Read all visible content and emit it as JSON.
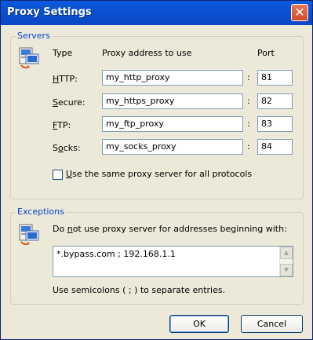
{
  "window": {
    "title": "Proxy Settings",
    "close_glyph": "✕"
  },
  "servers": {
    "group_label": "Servers",
    "headers": {
      "type": "Type",
      "address": "Proxy address to use",
      "port": "Port"
    },
    "rows": [
      {
        "label_accel": "H",
        "label_rest": "TTP:",
        "address": "my_http_proxy",
        "sep": ":",
        "port": "81"
      },
      {
        "label_accel": "S",
        "label_rest": "ecure:",
        "address": "my_https_proxy",
        "sep": ":",
        "port": "82"
      },
      {
        "label_accel": "F",
        "label_rest": "TP:",
        "address": "my_ftp_proxy",
        "sep": ":",
        "port": "83"
      },
      {
        "label_pre": "S",
        "label_accel": "o",
        "label_rest": "cks:",
        "address": "my_socks_proxy",
        "sep": ":",
        "port": "84"
      }
    ],
    "same_proxy": {
      "accel": "U",
      "rest": "se the same proxy server for all protocols",
      "checked": false
    }
  },
  "exceptions": {
    "group_label": "Exceptions",
    "desc_pre": "Do ",
    "desc_accel": "n",
    "desc_post": "ot use proxy server for addresses beginning with:",
    "value": "*.bypass.com ; 192.168.1.1",
    "hint": "Use semicolons ( ; ) to separate entries."
  },
  "buttons": {
    "ok": "OK",
    "cancel": "Cancel"
  },
  "icons": {
    "servers": "network-computer-icon",
    "exceptions": "network-computer-icon"
  }
}
